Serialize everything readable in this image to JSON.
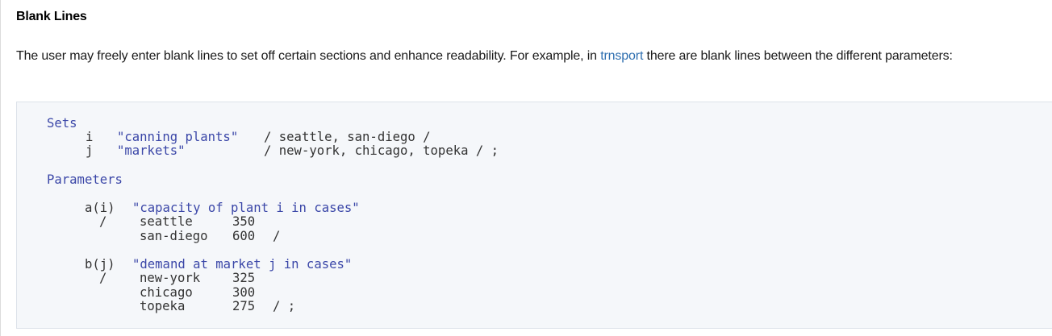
{
  "section": {
    "title": "Blank Lines"
  },
  "intro": {
    "text_before": "The user may freely enter blank lines to set off certain sections and enhance readability. For example, in ",
    "link": "trnsport",
    "text_after": " there are blank lines between the different parameters:"
  },
  "code": {
    "sets_keyword": "Sets",
    "sets": [
      {
        "name": "i",
        "text": "\"canning plants\"",
        "elements": "/ seattle, san-diego /"
      },
      {
        "name": "j",
        "text": "\"markets\"",
        "elements": "/ new-york, chicago, topeka / ;"
      }
    ],
    "parameters_keyword": "Parameters",
    "parameters": [
      {
        "decl": "a(i)",
        "text": "\"capacity of plant i in cases\"",
        "open": "/",
        "rows": [
          {
            "label": "seattle",
            "value": "350",
            "tail": ""
          },
          {
            "label": "san-diego",
            "value": "600",
            "tail": "/"
          }
        ]
      },
      {
        "decl": "b(j)",
        "text": "\"demand at market j in cases\"",
        "open": "/",
        "rows": [
          {
            "label": "new-york",
            "value": "325",
            "tail": ""
          },
          {
            "label": "chicago",
            "value": "300",
            "tail": ""
          },
          {
            "label": "topeka",
            "value": "275",
            "tail": "/ ;"
          }
        ]
      }
    ]
  },
  "colors": {
    "keyword": "#3b47a8",
    "link": "#2f6fb0",
    "code_background": "#f5f7fa"
  }
}
